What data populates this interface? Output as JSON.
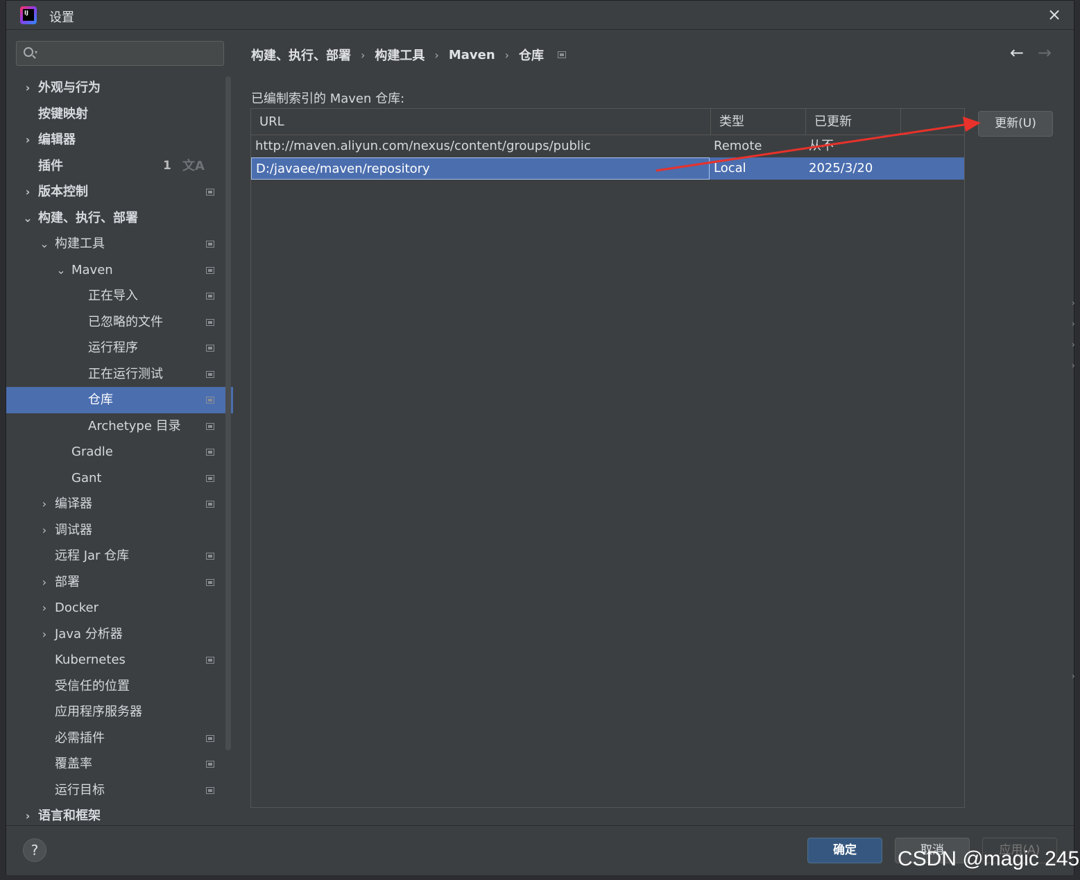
{
  "window": {
    "title": "设置",
    "close_icon": "×"
  },
  "sidebar": {
    "search_placeholder": "",
    "items": [
      {
        "label": "外观与行为",
        "bold": true,
        "chevron": "›",
        "level": 0
      },
      {
        "label": "按键映射",
        "bold": true,
        "chevron": "",
        "level": 0
      },
      {
        "label": "编辑器",
        "bold": true,
        "chevron": "›",
        "level": 0
      },
      {
        "label": "插件",
        "bold": true,
        "chevron": "",
        "level": 0,
        "badge": "1",
        "translate_icon": "文A"
      },
      {
        "label": "版本控制",
        "bold": true,
        "chevron": "›",
        "level": 0,
        "project_icon": true
      },
      {
        "label": "构建、执行、部署",
        "bold": true,
        "chevron": "⌄",
        "level": 0
      },
      {
        "label": "构建工具",
        "bold": false,
        "chevron": "⌄",
        "level": 1,
        "project_icon": true
      },
      {
        "label": "Maven",
        "bold": false,
        "chevron": "⌄",
        "level": 2,
        "project_icon": true
      },
      {
        "label": "正在导入",
        "bold": false,
        "chevron": "",
        "level": 3,
        "project_icon": true
      },
      {
        "label": "已忽略的文件",
        "bold": false,
        "chevron": "",
        "level": 3,
        "project_icon": true
      },
      {
        "label": "运行程序",
        "bold": false,
        "chevron": "",
        "level": 3,
        "project_icon": true
      },
      {
        "label": "正在运行测试",
        "bold": false,
        "chevron": "",
        "level": 3,
        "project_icon": true
      },
      {
        "label": "仓库",
        "bold": false,
        "chevron": "",
        "level": 3,
        "project_icon": true,
        "selected": true
      },
      {
        "label": "Archetype 目录",
        "bold": false,
        "chevron": "",
        "level": 3,
        "project_icon": true
      },
      {
        "label": "Gradle",
        "bold": false,
        "chevron": "",
        "level": 2,
        "project_icon": true
      },
      {
        "label": "Gant",
        "bold": false,
        "chevron": "",
        "level": 2,
        "project_icon": true
      },
      {
        "label": "编译器",
        "bold": false,
        "chevron": "›",
        "level": 1,
        "project_icon": true
      },
      {
        "label": "调试器",
        "bold": false,
        "chevron": "›",
        "level": 1
      },
      {
        "label": "远程 Jar 仓库",
        "bold": false,
        "chevron": "",
        "level": 1,
        "project_icon": true
      },
      {
        "label": "部署",
        "bold": false,
        "chevron": "›",
        "level": 1,
        "project_icon": true
      },
      {
        "label": "Docker",
        "bold": false,
        "chevron": "›",
        "level": 1
      },
      {
        "label": "Java 分析器",
        "bold": false,
        "chevron": "›",
        "level": 1
      },
      {
        "label": "Kubernetes",
        "bold": false,
        "chevron": "",
        "level": 1,
        "project_icon": true
      },
      {
        "label": "受信任的位置",
        "bold": false,
        "chevron": "",
        "level": 1
      },
      {
        "label": "应用程序服务器",
        "bold": false,
        "chevron": "",
        "level": 1
      },
      {
        "label": "必需插件",
        "bold": false,
        "chevron": "",
        "level": 1,
        "project_icon": true
      },
      {
        "label": "覆盖率",
        "bold": false,
        "chevron": "",
        "level": 1,
        "project_icon": true
      },
      {
        "label": "运行目标",
        "bold": false,
        "chevron": "",
        "level": 1,
        "project_icon": true
      },
      {
        "label": "语言和框架",
        "bold": true,
        "chevron": "›",
        "level": 0
      }
    ]
  },
  "breadcrumb": {
    "items": [
      "构建、执行、部署",
      "构建工具",
      "Maven",
      "仓库"
    ],
    "separator": "›",
    "back_icon": "←",
    "forward_icon": "→"
  },
  "main": {
    "section_label": "已编制索引的 Maven 仓库:",
    "table": {
      "columns": [
        "URL",
        "类型",
        "已更新",
        ""
      ],
      "rows": [
        {
          "url": "http://maven.aliyun.com/nexus/content/groups/public",
          "type": "Remote",
          "updated": "从不",
          "selected": false
        },
        {
          "url": "D:/javaee/maven/repository",
          "type": "Local",
          "updated": "2025/3/20",
          "selected": true
        }
      ]
    },
    "update_button": "更新(U)",
    "annotation_arrow_color": "#e8322b"
  },
  "footer": {
    "help_icon": "?",
    "ok_label": "确定",
    "cancel_label": "取消",
    "apply_label": "应用(A)"
  },
  "watermark": "CSDN @magic 245",
  "colors": {
    "background": "#3c3f41",
    "selection": "#4b6eaf",
    "ok_button": "#365880"
  }
}
